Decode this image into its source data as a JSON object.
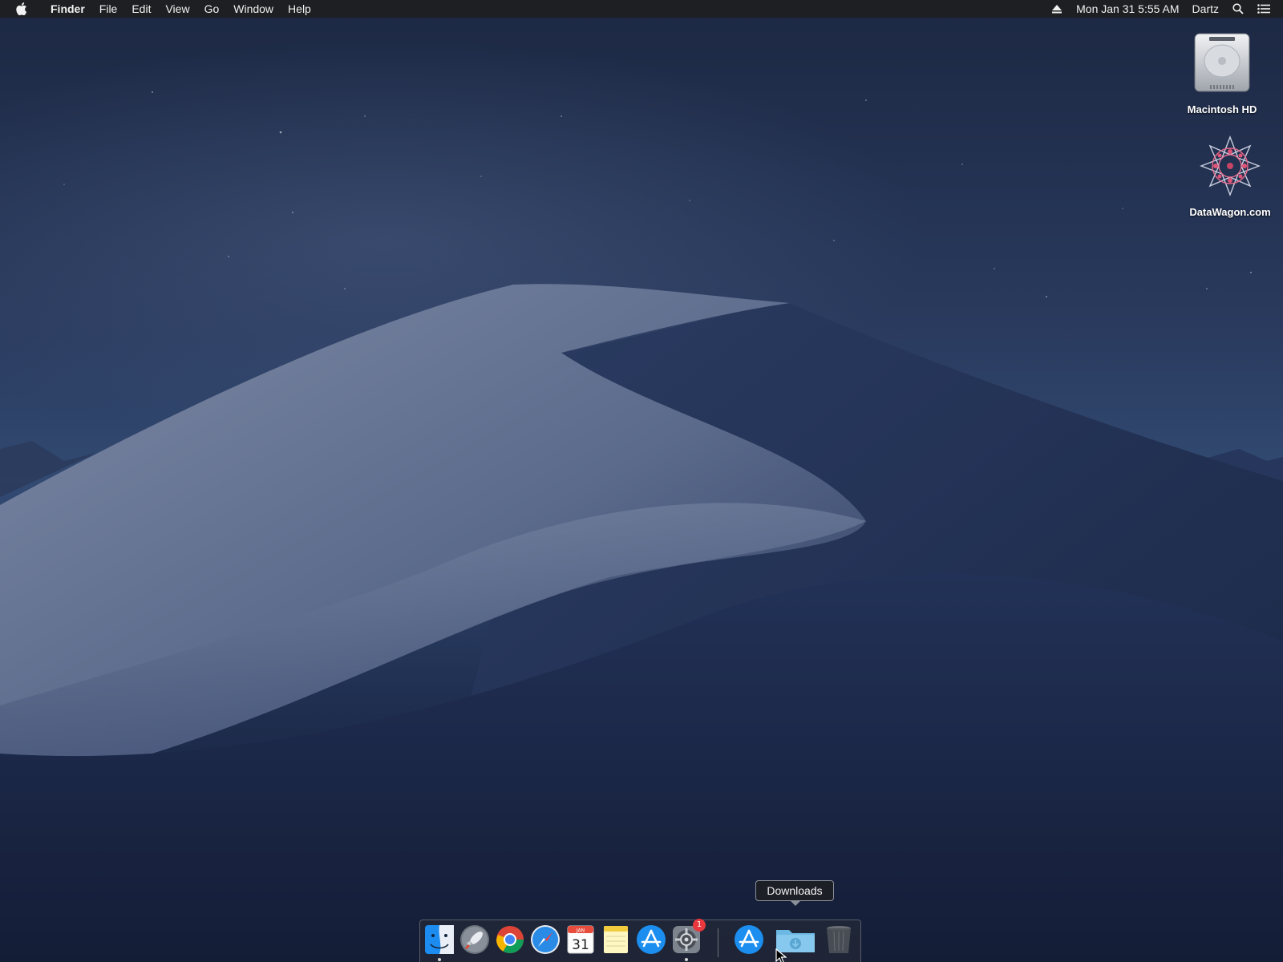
{
  "menubar": {
    "apple_icon": "apple-logo-icon",
    "app_name": "Finder",
    "menus": [
      "File",
      "Edit",
      "View",
      "Go",
      "Window",
      "Help"
    ],
    "eject_icon": "eject-icon",
    "datetime": "Mon Jan 31  5:55 AM",
    "user": "Dartz",
    "spotlight_icon": "search-icon",
    "notification_icon": "list-icon"
  },
  "desktop": {
    "icons": [
      {
        "label": "Macintosh HD",
        "icon": "hard-drive-icon"
      },
      {
        "label": "DataWagon.com",
        "icon": "mandala-disk-icon"
      }
    ]
  },
  "tooltip": {
    "text": "Downloads"
  },
  "dock": {
    "apps": [
      {
        "name": "Finder",
        "icon": "finder-icon",
        "running": true
      },
      {
        "name": "Launchpad",
        "icon": "rocket-icon",
        "running": false
      },
      {
        "name": "Chrome",
        "icon": "chrome-icon",
        "running": false
      },
      {
        "name": "Safari",
        "icon": "compass-icon",
        "running": false
      },
      {
        "name": "Calendar",
        "icon": "calendar-icon",
        "running": false,
        "month": "JAN",
        "day": "31"
      },
      {
        "name": "Notes",
        "icon": "notes-icon",
        "running": false
      },
      {
        "name": "App Store",
        "icon": "app-store-icon",
        "running": false
      },
      {
        "name": "System Preferences",
        "icon": "gear-icon",
        "running": true,
        "badge": "1"
      }
    ],
    "stacks": [
      {
        "name": "App Store Downloads",
        "icon": "app-store-icon"
      },
      {
        "name": "Downloads",
        "icon": "downloads-folder-icon"
      },
      {
        "name": "Trash",
        "icon": "trash-icon"
      }
    ]
  },
  "colors": {
    "menubar_bg": "#1e1e20",
    "badge": "#e8383d",
    "sky": "#24365a",
    "dune_light": "#6c7a98"
  }
}
